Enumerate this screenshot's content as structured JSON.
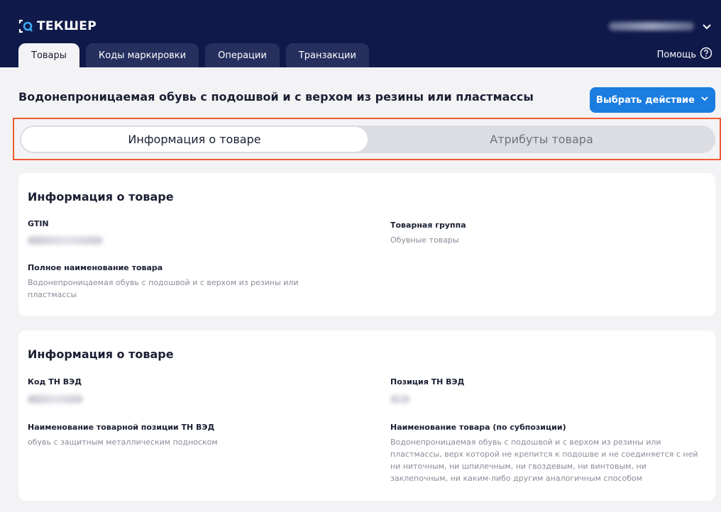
{
  "header": {
    "logo_text": "ТЕКШЕР",
    "help_label": "Помощь",
    "tabs": [
      {
        "label": "Товары",
        "active": true
      },
      {
        "label": "Коды маркировки",
        "active": false
      },
      {
        "label": "Операции",
        "active": false
      },
      {
        "label": "Транзакции",
        "active": false
      }
    ]
  },
  "page": {
    "title": "Водонепроницаемая обувь с подошвой и с верхом из резины или пластмассы",
    "action_button": "Выбрать действие"
  },
  "switcher": {
    "options": [
      "Информация о товаре",
      "Атрибуты товара"
    ],
    "selected": "Информация о товаре"
  },
  "cards": [
    {
      "title": "Информация о товаре",
      "fields": {
        "gtin_label": "GTIN",
        "group_label": "Товарная группа",
        "group_value": "Обувные товары",
        "fullname_label": "Полное наименование товара",
        "fullname_value": "Водонепроницаемая обувь с подошвой и с верхом из резины или пластмассы"
      }
    },
    {
      "title": "Информация о товаре",
      "fields": {
        "code_label": "Код ТН ВЭД",
        "position_label": "Позиция ТН ВЭД",
        "position_name_label": "Наименование товарной позиции ТН ВЭД",
        "position_name_value": "обувь с защитным металлическим подноском",
        "subposition_label": "Наименование товара (по субпозиции)",
        "subposition_value": "Водонепроницаемая обувь с подошвой и с верхом из резины или пластмассы, верх которой не крепится к подошве и не соединяется с ней ни ниточным, ни шпилечным, ни гвоздевым, ни винтовым, ни заклепочным, ни каким-либо другим аналогичным способом"
      }
    }
  ],
  "colors": {
    "header_bg": "#0f1a4a",
    "accent": "#1b7de0",
    "highlight_frame": "#f05a32",
    "logo_accent": "#3fa9f5"
  }
}
